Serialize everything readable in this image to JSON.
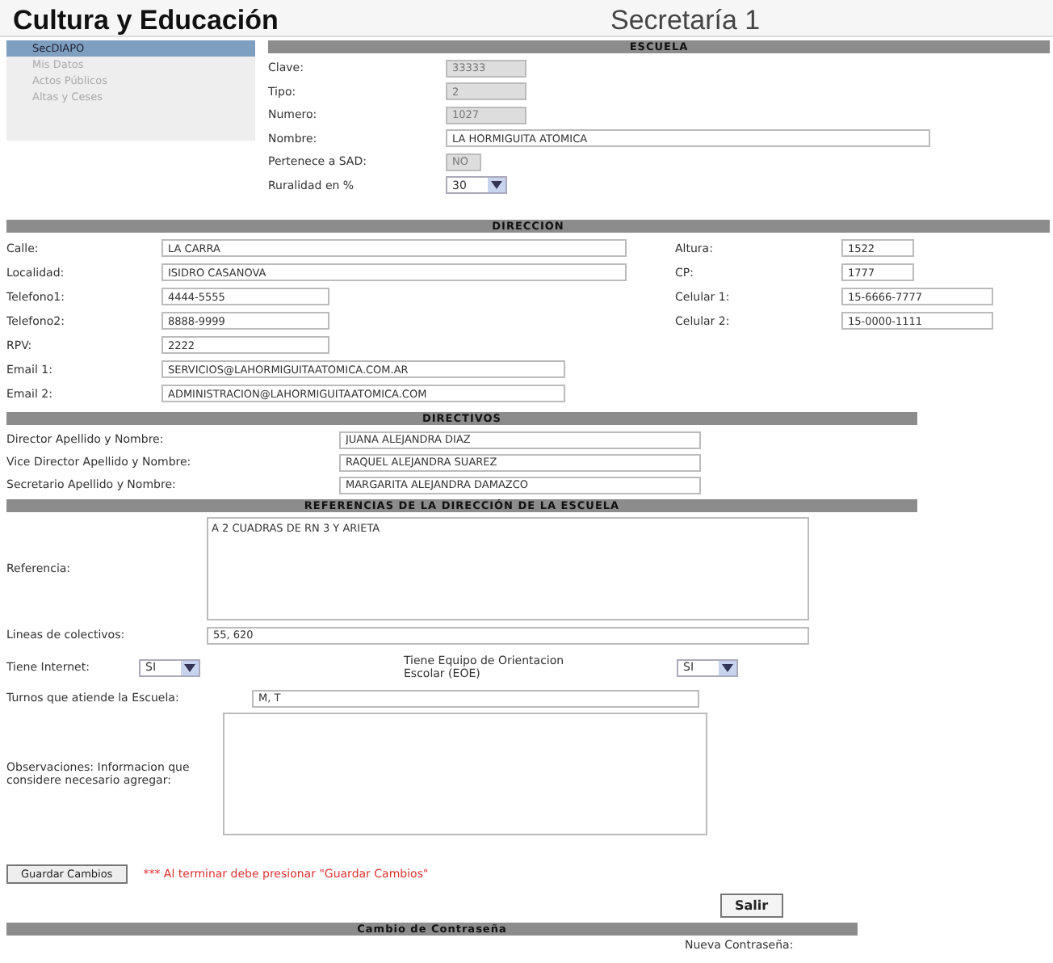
{
  "header": {
    "title": "Cultura y Educación",
    "subtitle": "Secretaría 1"
  },
  "sidebar": {
    "items": [
      {
        "label": "SecDIAPO",
        "selected": true
      },
      {
        "label": "Mis Datos",
        "selected": false
      },
      {
        "label": "Actos Públicos",
        "selected": false
      },
      {
        "label": "Altas y Ceses",
        "selected": false
      }
    ]
  },
  "escuela": {
    "title": "ESCUELA",
    "fields": [
      {
        "label": "Clave:",
        "value": "33333",
        "kind": "input",
        "disabled": true
      },
      {
        "label": "Tipo:",
        "value": "2",
        "kind": "input",
        "disabled": true
      },
      {
        "label": "Numero:",
        "value": "1027",
        "kind": "input",
        "disabled": true
      },
      {
        "label": "Nombre:",
        "value": "LA HORMIGUITA ATOMICA",
        "kind": "input",
        "disabled": false
      },
      {
        "label": "Pertenece a SAD:",
        "value": "NO",
        "kind": "input",
        "disabled": true
      },
      {
        "label": "Ruralidad en %",
        "value": "30",
        "kind": "select"
      }
    ]
  },
  "direccion": {
    "title": "DIRECCION",
    "rows": [
      [
        {
          "label": "Calle:",
          "value": "LA CARRA"
        },
        {
          "label": "Altura:",
          "value": "1522"
        }
      ],
      [
        {
          "label": "Localidad:",
          "value": "ISIDRO CASANOVA"
        },
        {
          "label": "CP:",
          "value": "1777"
        }
      ],
      [
        {
          "label": "Telefono1:",
          "value": "4444-5555"
        },
        {
          "label": "Celular 1:",
          "value": "15-6666-7777"
        }
      ],
      [
        {
          "label": "Telefono2:",
          "value": "8888-9999"
        },
        {
          "label": "Celular 2:",
          "value": "15-0000-1111"
        }
      ],
      [
        {
          "label": "RPV:",
          "value": "2222"
        }
      ],
      [
        {
          "label": "Email 1:",
          "value": "SERVICIOS@LAHORMIGUITAATOMICA.COM.AR"
        }
      ],
      [
        {
          "label": "Email 2:",
          "value": "ADMINISTRACION@LAHORMIGUITAATOMICA.COM"
        }
      ]
    ]
  },
  "directivos": {
    "title": "DIRECTIVOS",
    "fields": [
      {
        "label": "Director Apellido y Nombre:",
        "value": "JUANA ALEJANDRA DIAZ"
      },
      {
        "label": "Vice Director Apellido y Nombre:",
        "value": "RAQUEL ALEJANDRA SUAREZ"
      },
      {
        "label": "Secretario Apellido y Nombre:",
        "value": "MARGARITA ALEJANDRA DAMAZCO"
      }
    ]
  },
  "referencias": {
    "title": "REFERENCIAS DE LA DIRECCIÓN DE LA ESCUELA",
    "referencia": {
      "label": "Referencia:",
      "value": "A 2 CUADRAS DE RN 3 Y ARIETA"
    },
    "lineas": {
      "label": "Lineas de colectivos:",
      "value": "55, 620"
    },
    "internet": {
      "label": "Tiene Internet:",
      "value": "SI"
    },
    "eoe": {
      "label": "Tiene Equipo de Orientacion Escolar (EOE)",
      "value": "SI"
    },
    "turnos": {
      "label": "Turnos que atiende la Escuela:",
      "value": "M, T"
    },
    "observaciones": {
      "label": "Observaciones: Informacion que considere necesario agregar:"
    }
  },
  "save_button": "Guardar Cambios",
  "save_hint": "*** Al terminar debe presionar \"Guardar Cambios\"",
  "exit_button": "Salir",
  "password": {
    "title": "Cambio de Contraseña",
    "label": "Nueva Contraseña:"
  }
}
